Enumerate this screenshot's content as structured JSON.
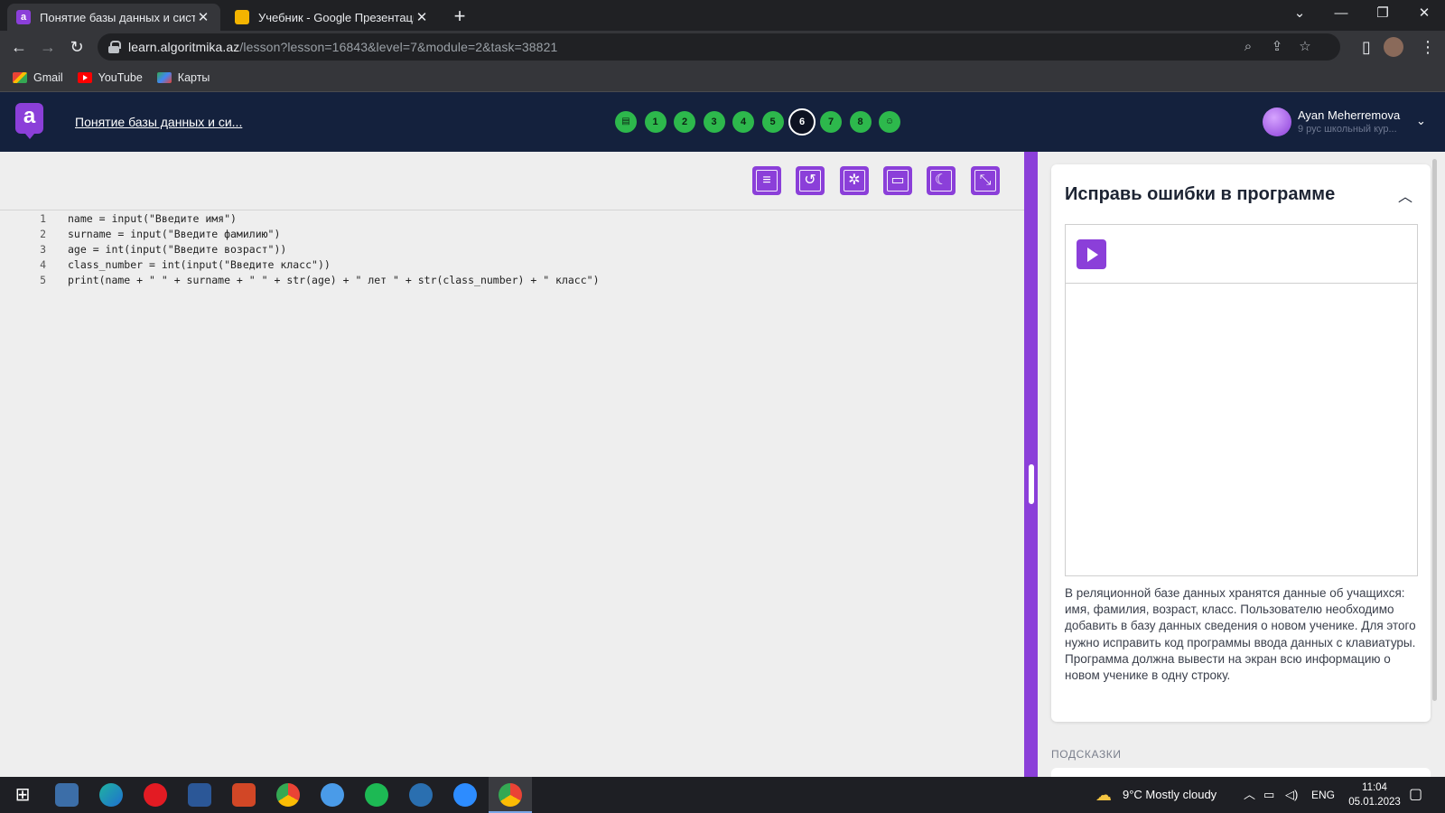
{
  "browser": {
    "tabs": [
      {
        "title": "Понятие базы данных и систем",
        "active": true
      },
      {
        "title": "Учебник - Google Презентации",
        "active": false
      }
    ],
    "url_host": "learn.algoritmika.az",
    "url_path": "/lesson?lesson=16843&level=7&module=2&task=38821",
    "bookmarks": [
      "Gmail",
      "YouTube",
      "Карты"
    ]
  },
  "header": {
    "logo_letter": "a",
    "lesson_title": "Понятие базы данных и си...",
    "steps": [
      {
        "label": "",
        "kind": "intro-icon"
      },
      {
        "label": "1"
      },
      {
        "label": "2"
      },
      {
        "label": "3"
      },
      {
        "label": "4"
      },
      {
        "label": "5"
      },
      {
        "label": "6",
        "current": true
      },
      {
        "label": "7"
      },
      {
        "label": "8"
      },
      {
        "label": "",
        "kind": "finish-icon"
      }
    ],
    "user_name": "Ayan Meherremova",
    "user_sub": "9 рус школьный кур..."
  },
  "editor": {
    "toolbar_icons": [
      "chat-help-icon",
      "undo-icon",
      "debug-icon",
      "save-icon",
      "dark-mode-icon",
      "fullscreen-icon"
    ],
    "lines": [
      {
        "n": "1",
        "code": "name = input(\"Введите имя\")"
      },
      {
        "n": "2",
        "code": "surname = input(\"Введите фамилию\")"
      },
      {
        "n": "3",
        "code": "age = int(input(\"Введите возраст\"))"
      },
      {
        "n": "4",
        "code": "class_number = int(input(\"Введите класс\"))"
      },
      {
        "n": "5",
        "code": "print(name + \" \" + surname + \" \" + str(age) + \" лет \" + str(class_number) + \" класс\")"
      }
    ]
  },
  "task": {
    "title": "Исправь ошибки в программе",
    "description": "В реляционной базе данных хранятся данные об учащихся: имя, фамилия, возраст, класс. Пользователю необходимо добавить в базу данных сведения о новом ученике. Для этого нужно исправить код программы ввода данных с клавиатуры. Программа должна вывести на экран всю информацию о новом ученике в одну строку.",
    "hints_label": "ПОДСКАЗКИ"
  },
  "taskbar": {
    "weather": "9°C  Mostly cloudy",
    "lang": "ENG",
    "time": "11:04",
    "date": "05.01.2023"
  },
  "colors": {
    "accent": "#8b3fd9",
    "header_bg": "#14213d",
    "step_done": "#2db84c",
    "editor_bg": "#eeeeee"
  }
}
